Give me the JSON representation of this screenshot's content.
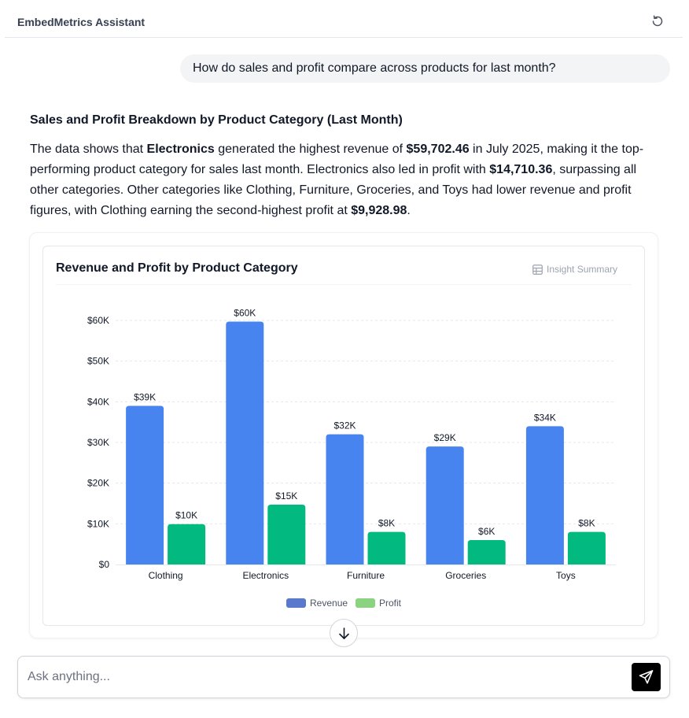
{
  "header": {
    "title": "EmbedMetrics Assistant",
    "reset_icon": "refresh-icon"
  },
  "user_message": {
    "text": "How do sales and profit compare across products for last month?"
  },
  "answer": {
    "heading": "Sales and Profit Breakdown by Product Category (Last Month)",
    "p1": "The data shows that ",
    "b1": "Electronics",
    "p2": " generated the highest revenue of ",
    "b2": "$59,702.46",
    "p3": " in July 2025, making it the top-performing product category for sales last month. Electronics also led in profit with ",
    "b3": "$14,710.36",
    "p4": ", surpassing all other categories. Other categories like Clothing, Furniture, Groceries, and Toys had lower revenue and profit figures, with Clothing earning the second-highest profit at ",
    "b4": "$9,928.98",
    "p5": "."
  },
  "chart_card": {
    "title": "Revenue and Profit by Product Category",
    "insight_label": "Insight Summary",
    "insight_icon": "table-icon"
  },
  "chart_data": {
    "type": "bar",
    "title": "Revenue and Profit by Product Category",
    "xlabel": "",
    "ylabel": "",
    "categories": [
      "Clothing",
      "Electronics",
      "Furniture",
      "Groceries",
      "Toys"
    ],
    "series": [
      {
        "name": "Revenue",
        "values": [
          39000,
          59702.46,
          32000,
          29000,
          34000
        ],
        "labels": [
          "$39K",
          "$60K",
          "$32K",
          "$29K",
          "$34K"
        ],
        "color": "#4784f0",
        "legend_color": "#5b79cc"
      },
      {
        "name": "Profit",
        "values": [
          9928.98,
          14710.36,
          8000,
          6000,
          8000
        ],
        "labels": [
          "$10K",
          "$15K",
          "$8K",
          "$6K",
          "$8K"
        ],
        "color": "#02b97f",
        "legend_color": "#8bd281"
      }
    ],
    "ylim": [
      0,
      60000
    ],
    "yticks": [
      0,
      10000,
      20000,
      30000,
      40000,
      50000,
      60000
    ],
    "ytick_labels": [
      "$0",
      "$10K",
      "$20K",
      "$30K",
      "$40K",
      "$50K",
      "$60K"
    ],
    "grid": true,
    "legend": "bottom-center"
  },
  "scroll_button": {
    "icon": "arrow-down-icon"
  },
  "composer": {
    "placeholder": "Ask anything...",
    "send_icon": "send-icon"
  },
  "colors": {
    "accent": "#000000",
    "bubble_bg": "#f3f4f6",
    "border": "#e5e7eb"
  }
}
